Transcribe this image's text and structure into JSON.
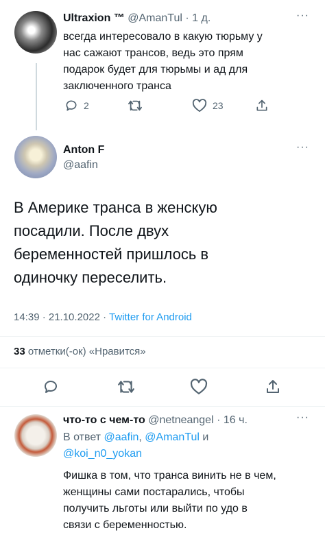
{
  "tweet1": {
    "display_name": "Ultraxion ™",
    "handle": "@AmanTul",
    "time": "· 1 д.",
    "text_lines": [
      "всегда интересовало в какую тюрьму у",
      "нас сажают трансов, ведь это прям",
      "подарок будет для тюрьмы и ад для",
      "заключенного транса"
    ],
    "reply_count": "2",
    "like_count": "23"
  },
  "tweet2": {
    "display_name": "Anton F",
    "handle": "@aafin",
    "text_lines": [
      "В Америке транса в женскую",
      "посадили. После двух",
      "беременностей пришлось в",
      "одиночку переселить."
    ],
    "time": "14:39 · 21.10.2022 · ",
    "source": "Twitter for Android",
    "likes_count": "33",
    "likes_label": "отметки(-ок) «Нравится»"
  },
  "tweet3": {
    "display_name": "что-то с чем-то",
    "handle": "@netneangel",
    "time": "· 16 ч.",
    "reply_prefix": "В ответ ",
    "reply_to_1": "@aafin",
    "reply_sep": ", ",
    "reply_to_2": "@AmanTul",
    "reply_and": " и",
    "reply_to_3": "@koi_n0_yokan",
    "text_lines": [
      "Фишка в том, что транса винить не в чем,",
      "женщины сами постарались, чтобы",
      "получить льготы или выйти по удо в",
      "связи с беременностью."
    ]
  },
  "colors": {
    "accent": "#1d9bf0",
    "secondary_text": "#536471",
    "divider": "#eff3f4"
  },
  "icons": [
    "reply-icon",
    "retweet-icon",
    "like-icon",
    "share-icon",
    "more-icon"
  ]
}
